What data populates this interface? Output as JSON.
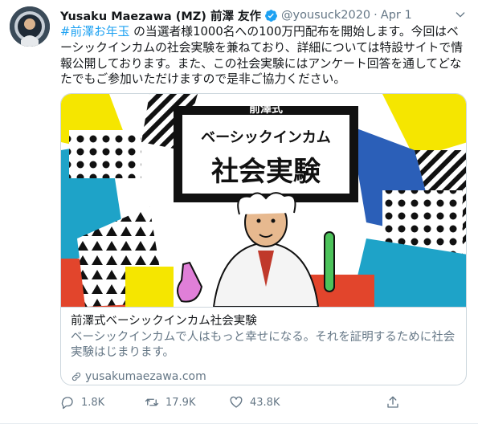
{
  "tweet": {
    "author_name": "Yusaku Maezawa (MZ) 前澤 友作",
    "handle": "@yousuck2020",
    "separator": "·",
    "date": "Apr 1",
    "hashtag": "#前澤お年玉",
    "body": " の当選者様1000名への100万円配布を開始します。今回はベーシックインカムの社会実験を兼ねており、詳細については特設サイトで情報公開しております。また、この社会実験にはアンケート回答を通してどなたでもご参加いただけますので是非ご協力ください。"
  },
  "card": {
    "image": {
      "small_label": "前澤式",
      "line1": "ベーシックインカム",
      "line2": "社会実験"
    },
    "title": "前澤式ベーシックインカム社会実験",
    "description": "ベーシックインカムで人はもっと幸せになる。それを証明するために社会実験はじまります。",
    "domain": "yusakumaezawa.com"
  },
  "actions": {
    "replies": "1.8K",
    "retweets": "17.9K",
    "likes": "43.8K"
  },
  "colors": {
    "link_blue": "#1da1f2",
    "muted": "#657786",
    "card_yellow": "#f5e600",
    "card_red": "#e2452c",
    "card_teal": "#1ea3c8"
  },
  "icons": [
    "verified-badge-icon",
    "caret-down-icon",
    "link-icon",
    "reply-icon",
    "retweet-icon",
    "like-icon",
    "share-icon"
  ]
}
